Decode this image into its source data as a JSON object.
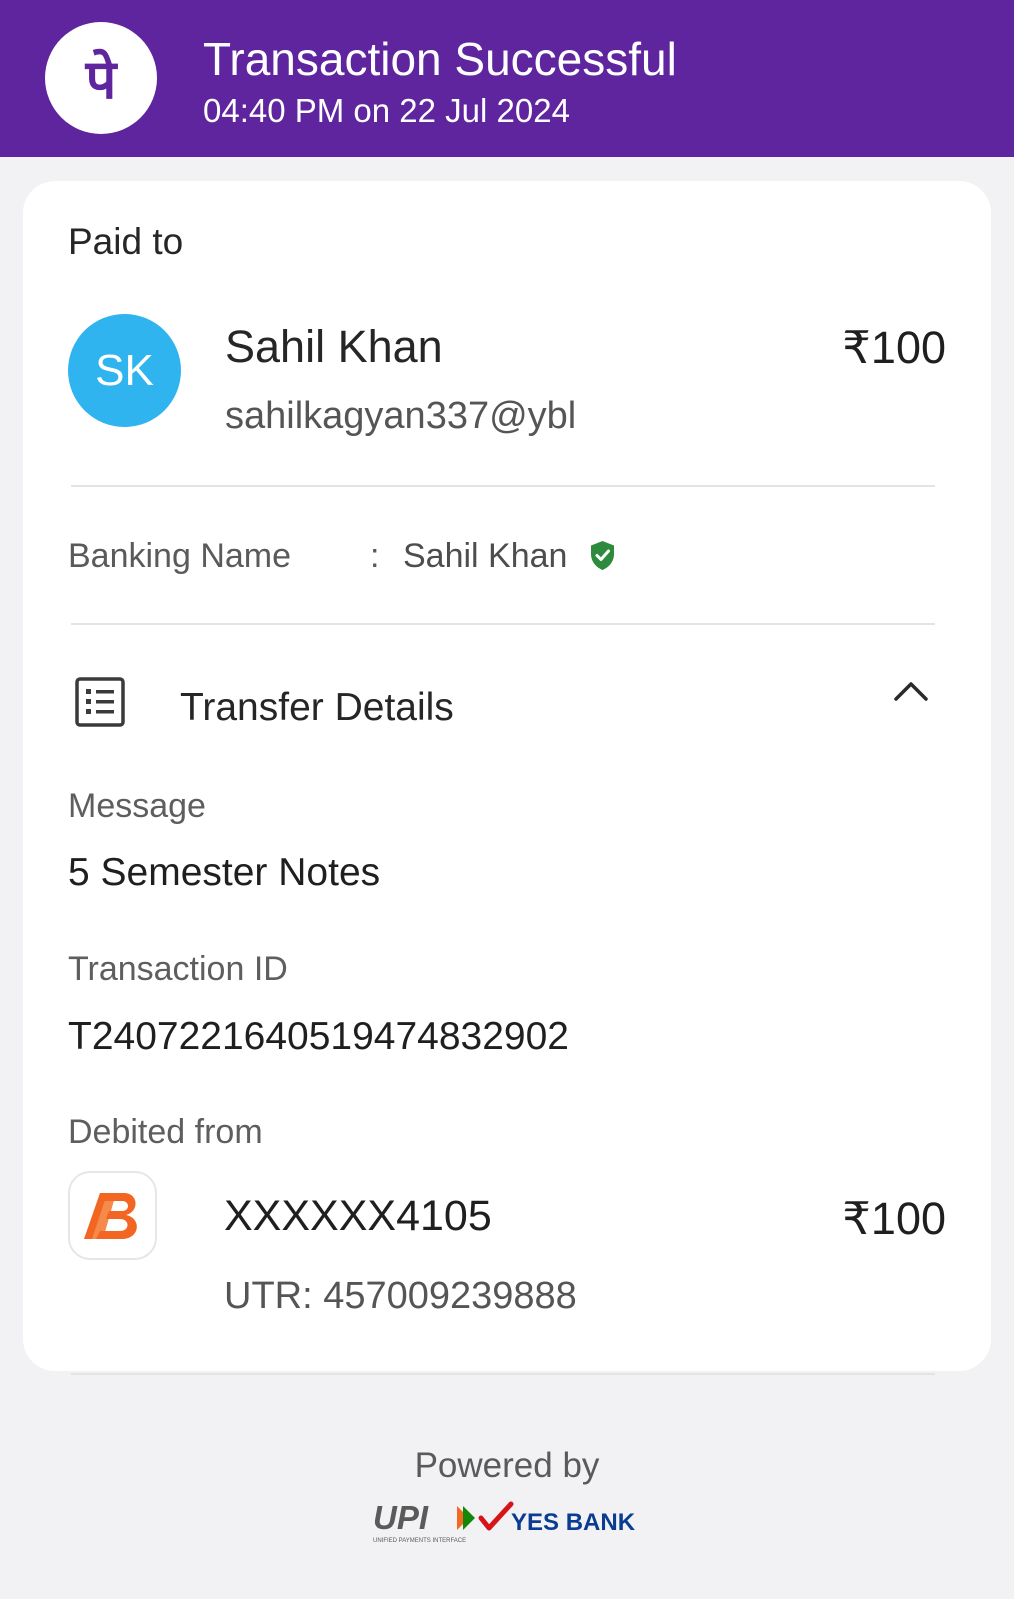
{
  "header": {
    "title": "Transaction Successful",
    "datetime": "04:40 PM on 22 Jul 2024",
    "logo_icon": "phonepe-logo-icon",
    "logo_glyph": "पे",
    "background": "#5f259f"
  },
  "paid_to": {
    "label": "Paid to",
    "avatar_initials": "SK",
    "avatar_color": "#2fb4ef",
    "name": "Sahil  Khan",
    "upi_id": "sahilkagyan337@ybl",
    "amount": "₹100"
  },
  "banking_name": {
    "label": "Banking Name",
    "separator": ":",
    "value": "Sahil  Khan",
    "verified_icon": "verified-shield-icon",
    "verified_color": "#2e8b3d"
  },
  "transfer_details": {
    "icon": "receipt-list-icon",
    "title": "Transfer Details",
    "toggle_icon": "chevron-up-icon",
    "message_label": "Message",
    "message_value": "5 Semester Notes",
    "transaction_id_label": "Transaction ID",
    "transaction_id_value": "T2407221640519474832902",
    "debited_from_label": "Debited from",
    "bank_logo_icon": "bank-of-baroda-logo-icon",
    "bank_logo_color": "#f26522",
    "account_number": "XXXXXX4105",
    "amount": "₹100",
    "utr": "UTR: 457009239888"
  },
  "footer": {
    "powered_by": "Powered by",
    "upi_logo_text": "UPI",
    "upi_tagline": "UNIFIED PAYMENTS INTERFACE",
    "bank_logo_text": "YES BANK",
    "yes_bank_color": "#0a3d91"
  }
}
